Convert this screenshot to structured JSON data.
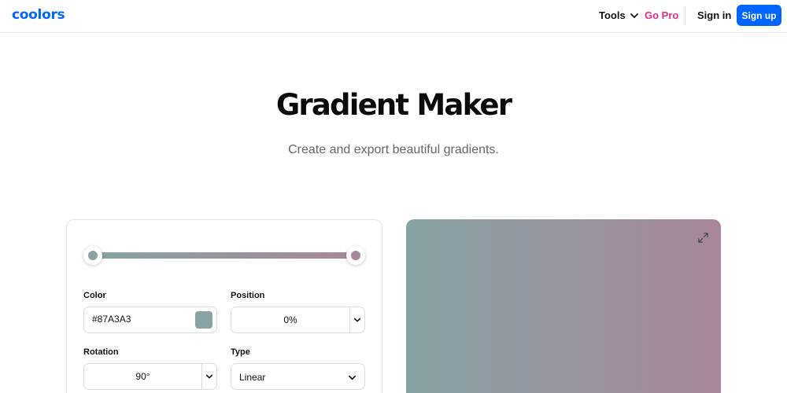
{
  "header": {
    "logo": "coolors",
    "tools_label": "Tools",
    "gopro_label": "Go Pro",
    "signin_label": "Sign in",
    "signup_label": "Sign up"
  },
  "hero": {
    "title": "Gradient Maker",
    "subtitle": "Create and export beautiful gradients."
  },
  "controls": {
    "color_label": "Color",
    "color_value": "#87A3A3",
    "position_label": "Position",
    "position_value": "0%",
    "rotation_label": "Rotation",
    "rotation_value": "90°",
    "type_label": "Type",
    "type_value": "Linear"
  },
  "gradient": {
    "stops": [
      {
        "color": "#87A3A3",
        "position": 0
      },
      {
        "color": "#A7879A",
        "position": 100
      }
    ]
  },
  "colors": {
    "brand": "#0066ff",
    "gopro": "#e52b8a"
  },
  "icons": {
    "tools_dropdown": "chevron-down-icon",
    "expand": "expand-icon"
  }
}
